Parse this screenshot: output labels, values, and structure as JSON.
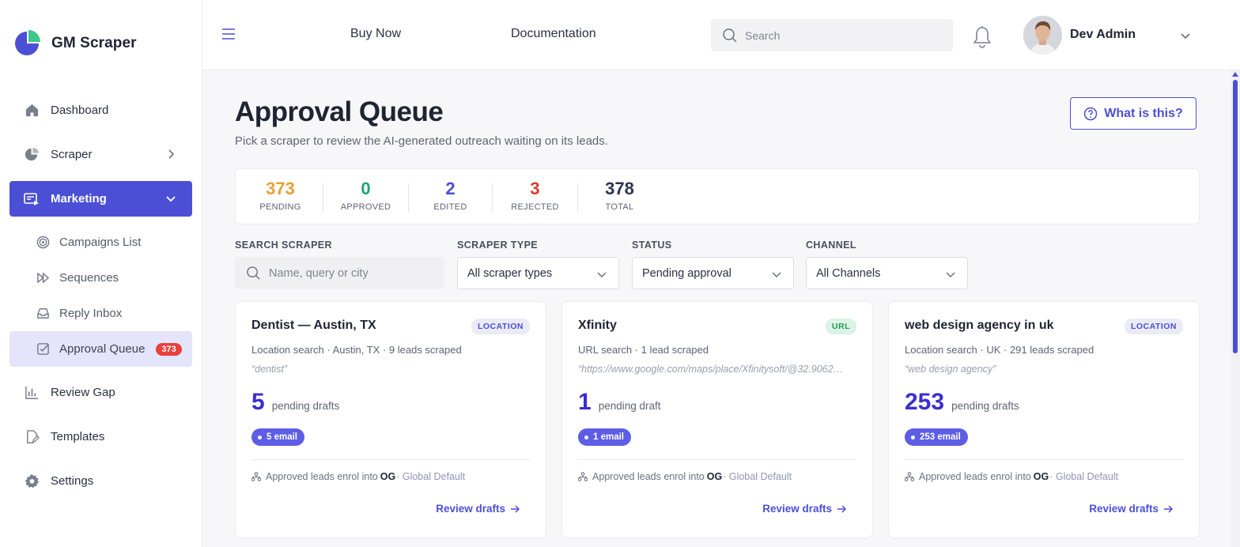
{
  "app": {
    "name": "GM Scraper"
  },
  "sidebar": {
    "items": [
      {
        "label": "Dashboard",
        "icon": "home-icon"
      },
      {
        "label": "Scraper",
        "icon": "pie-chart-icon"
      },
      {
        "label": "Marketing",
        "icon": "marketing-icon"
      }
    ],
    "sub_items": [
      {
        "label": "Campaigns List",
        "icon": "target-icon"
      },
      {
        "label": "Sequences",
        "icon": "fast-forward-icon"
      },
      {
        "label": "Reply Inbox",
        "icon": "inbox-icon"
      },
      {
        "label": "Approval Queue",
        "icon": "check-square-icon",
        "badge": "373"
      }
    ],
    "bottom_items": [
      {
        "label": "Review Gap",
        "icon": "bar-chart-icon"
      },
      {
        "label": "Templates",
        "icon": "file-edit-icon"
      },
      {
        "label": "Settings",
        "icon": "gear-icon"
      }
    ]
  },
  "topbar": {
    "buy_now": "Buy Now",
    "documentation": "Documentation",
    "search_placeholder": "Search",
    "user_name": "Dev Admin"
  },
  "page": {
    "title": "Approval Queue",
    "subtitle": "Pick a scraper to review the AI-generated outreach waiting on its leads.",
    "help_label": "What is this?"
  },
  "stats": [
    {
      "value": "373",
      "label": "PENDING",
      "color": "#e8a033"
    },
    {
      "value": "0",
      "label": "APPROVED",
      "color": "#1fa571"
    },
    {
      "value": "2",
      "label": "EDITED",
      "color": "#4b4fd6"
    },
    {
      "value": "3",
      "label": "REJECTED",
      "color": "#d93b30"
    },
    {
      "value": "378",
      "label": "TOTAL",
      "color": "#2d3352"
    }
  ],
  "filters": {
    "search_label": "SEARCH SCRAPER",
    "search_placeholder": "Name, query or city",
    "type_label": "SCRAPER TYPE",
    "type_value": "All scraper types",
    "status_label": "STATUS",
    "status_value": "Pending approval",
    "channel_label": "CHANNEL",
    "channel_value": "All Channels"
  },
  "cards": [
    {
      "title": "Dentist — Austin, TX",
      "tag": "LOCATION",
      "meta": "Location search · Austin, TX · 9 leads scraped",
      "query": "“dentist”",
      "count": "5",
      "count_label": "pending drafts",
      "pill": "5 email",
      "enrol_text": "Approved leads enrol into",
      "enrol_strong": "OG",
      "enrol_default": "· Global Default",
      "review": "Review drafts"
    },
    {
      "title": "Xfinity",
      "tag": "URL",
      "meta": "URL search · 1 lead scraped",
      "query": "“https://www.google.com/maps/place/Xfinitysoft/@32.9062…",
      "count": "1",
      "count_label": "pending draft",
      "pill": "1 email",
      "enrol_text": "Approved leads enrol into",
      "enrol_strong": "OG",
      "enrol_default": "· Global Default",
      "review": "Review drafts"
    },
    {
      "title": "web design agency in uk",
      "tag": "LOCATION",
      "meta": "Location search · UK · 291 leads scraped",
      "query": "“web design agency”",
      "count": "253",
      "count_label": "pending drafts",
      "pill": "253 email",
      "enrol_text": "Approved leads enrol into",
      "enrol_strong": "OG",
      "enrol_default": "· Global Default",
      "review": "Review drafts"
    }
  ]
}
